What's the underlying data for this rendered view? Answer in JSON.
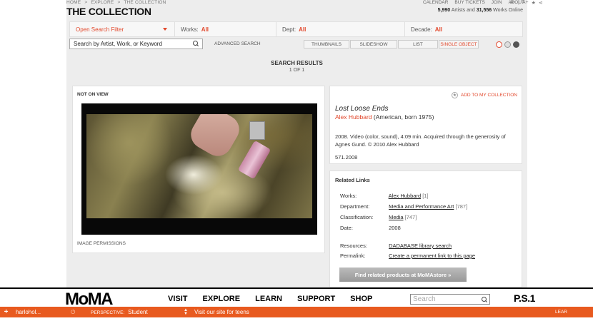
{
  "breadcrumb": [
    "HOME",
    ">",
    "EXPLORE",
    ">",
    "THE COLLECTION"
  ],
  "page_title": "THE COLLECTION",
  "top_links": [
    "CALENDAR",
    "BUY TICKETS",
    "JOIN",
    "ABOUT"
  ],
  "font_controls": {
    "smaller": "A-",
    "separator": "|",
    "larger": "A+"
  },
  "counts": {
    "artists": "5,990",
    "artists_label": "Artists and",
    "works": "31,556",
    "works_label": "Works Online"
  },
  "filters": {
    "open_search": "Open Search Filter",
    "works_label": "Works:",
    "works_value": "All",
    "dept_label": "Dept:",
    "dept_value": "All",
    "decade_label": "Decade:",
    "decade_value": "All"
  },
  "search": {
    "placeholder": "Search by Artist, Work, or Keyword",
    "advanced": "ADVANCED SEARCH"
  },
  "views": [
    "THUMBNAILS",
    "SLIDESHOW",
    "LIST",
    "SINGLE OBJECT"
  ],
  "results": {
    "heading": "SEARCH RESULTS",
    "paging": "1 OF 1"
  },
  "left_panel": {
    "status": "NOT ON VIEW",
    "image_permissions": "IMAGE PERMISSIONS"
  },
  "artwork": {
    "add_to_collection": "ADD TO MY COLLECTION",
    "title": "Lost Loose Ends",
    "artist": "Alex Hubbard",
    "artist_info": "(American, born 1975)",
    "description": "2008. Video (color, sound), 4:09 min. Acquired through the generosity of Agnes Gund. © 2010 Alex Hubbard",
    "accession": "571.2008"
  },
  "related": {
    "heading": "Related Links",
    "rows": [
      {
        "label": "Works:",
        "value": "Alex Hubbard",
        "count": "[1]"
      },
      {
        "label": "Department:",
        "value": "Media and Performance Art",
        "count": "[787]"
      },
      {
        "label": "Classification:",
        "value": "Media",
        "count": "[747]"
      },
      {
        "label": "Date:",
        "value": "2008",
        "count": ""
      }
    ],
    "resources_label": "Resources:",
    "resources_value": "DADABASE library search",
    "permalink_label": "Permalink:",
    "permalink_value": "Create a permanent link to this page",
    "store_button": "Find related products at MoMAstore »"
  },
  "footer": {
    "logo": "MoMA",
    "nav": [
      "VISIT",
      "EXPLORE",
      "LEARN",
      "SUPPORT",
      "SHOP"
    ],
    "search_placeholder": "Search",
    "ps1": "P.S.1"
  },
  "bottom_bar": {
    "plus": "+",
    "user": "harlohol...",
    "perspective_label": "PERSPECTIVE:",
    "perspective_value": "Student",
    "visit_text": "Visit our site for teens",
    "learn": "LEAR"
  },
  "colors": {
    "accent": "#e2472b",
    "bar": "#e85a1f"
  }
}
